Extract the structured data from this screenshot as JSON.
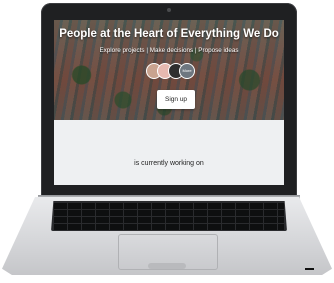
{
  "hero": {
    "title": "People at the Heart of Everything We Do",
    "links": [
      "Explore projects",
      "Make decisions",
      "Propose ideas"
    ],
    "separator": "|",
    "avatar_badge": "More"
  },
  "signup_label": "Sign up",
  "status_text": "is currently working on"
}
